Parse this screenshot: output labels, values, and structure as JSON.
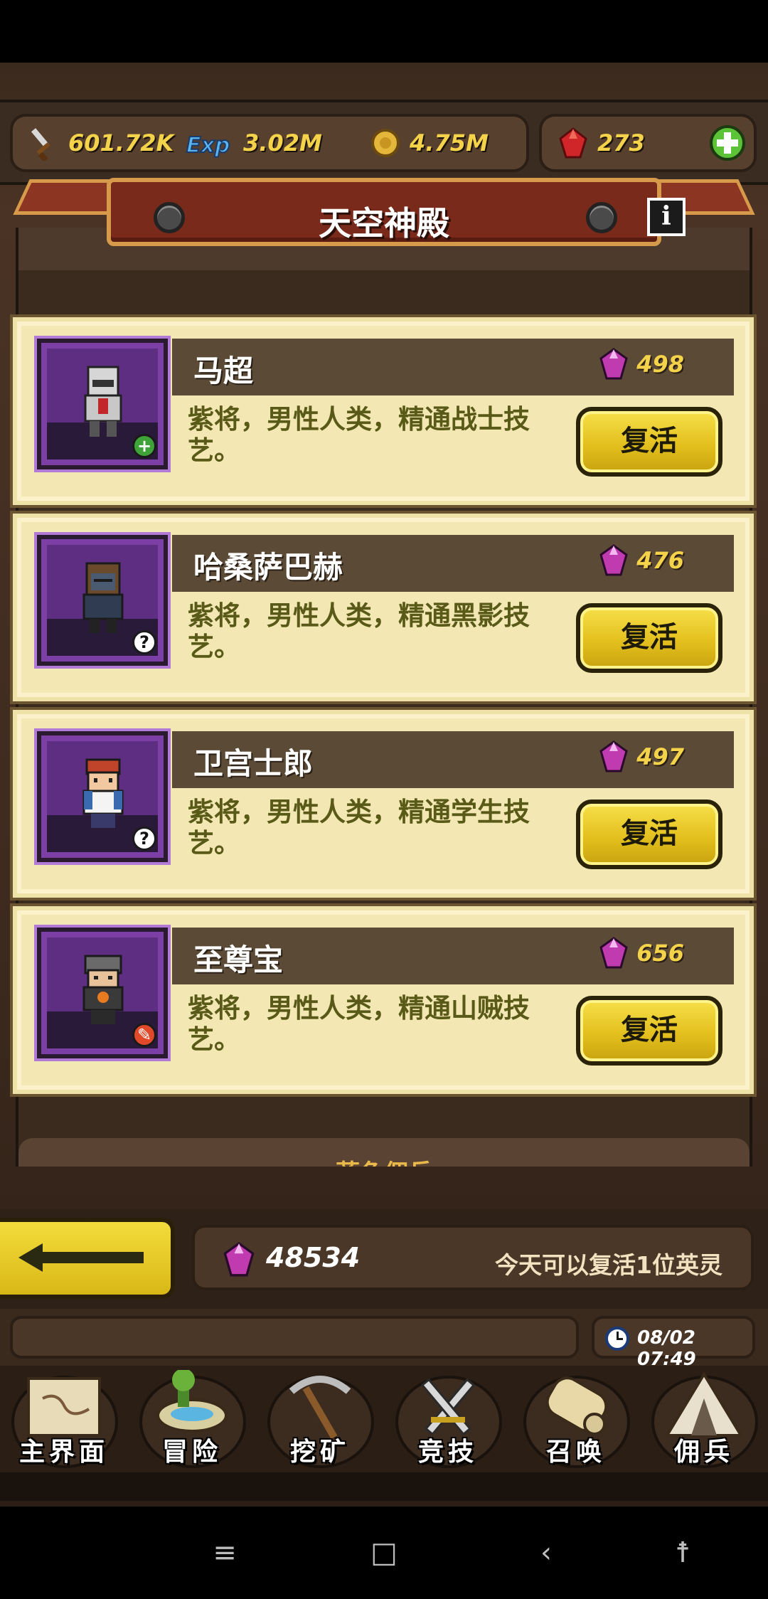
{
  "resources": {
    "attack": "601.72K",
    "exp": "3.02M",
    "gold": "4.75M",
    "ruby": "273"
  },
  "banner": {
    "title": "天空神殿"
  },
  "section_next": "蓝色佣兵",
  "heroes": [
    {
      "name": "马超",
      "cost": "498",
      "desc": "紫将，男性人类，精通战士技艺。",
      "revive_label": "复活",
      "badge": "+",
      "badge_color": "#3fa33a"
    },
    {
      "name": "哈桑萨巴赫",
      "cost": "476",
      "desc": "紫将，男性人类，精通黑影技艺。",
      "revive_label": "复活",
      "badge": "?",
      "badge_color": "#ffffff"
    },
    {
      "name": "卫宫士郎",
      "cost": "497",
      "desc": "紫将，男性人类，精通学生技艺。",
      "revive_label": "复活",
      "badge": "?",
      "badge_color": "#ffffff"
    },
    {
      "name": "至尊宝",
      "cost": "656",
      "desc": "紫将，男性人类，精通山贼技艺。",
      "revive_label": "复活",
      "badge": "✎",
      "badge_color": "#e04a2a"
    }
  ],
  "footer": {
    "gem_total": "48534",
    "revive_hint": "今天可以复活1位英灵",
    "time": "08/02 07:49"
  },
  "nav": [
    {
      "label": "主界面",
      "icon": "map-scroll-icon"
    },
    {
      "label": "冒险",
      "icon": "floating-island-icon"
    },
    {
      "label": "挖矿",
      "icon": "pickaxe-icon"
    },
    {
      "label": "竞技",
      "icon": "crossed-swords-icon"
    },
    {
      "label": "召唤",
      "icon": "summon-scroll-icon"
    },
    {
      "label": "佣兵",
      "icon": "tent-icon"
    }
  ],
  "colors": {
    "gold_text": "#f4d24a",
    "card_bg": "#f3e7b3",
    "revive_button": "#e3c01e",
    "portrait_purple": "#7b3fa6"
  }
}
